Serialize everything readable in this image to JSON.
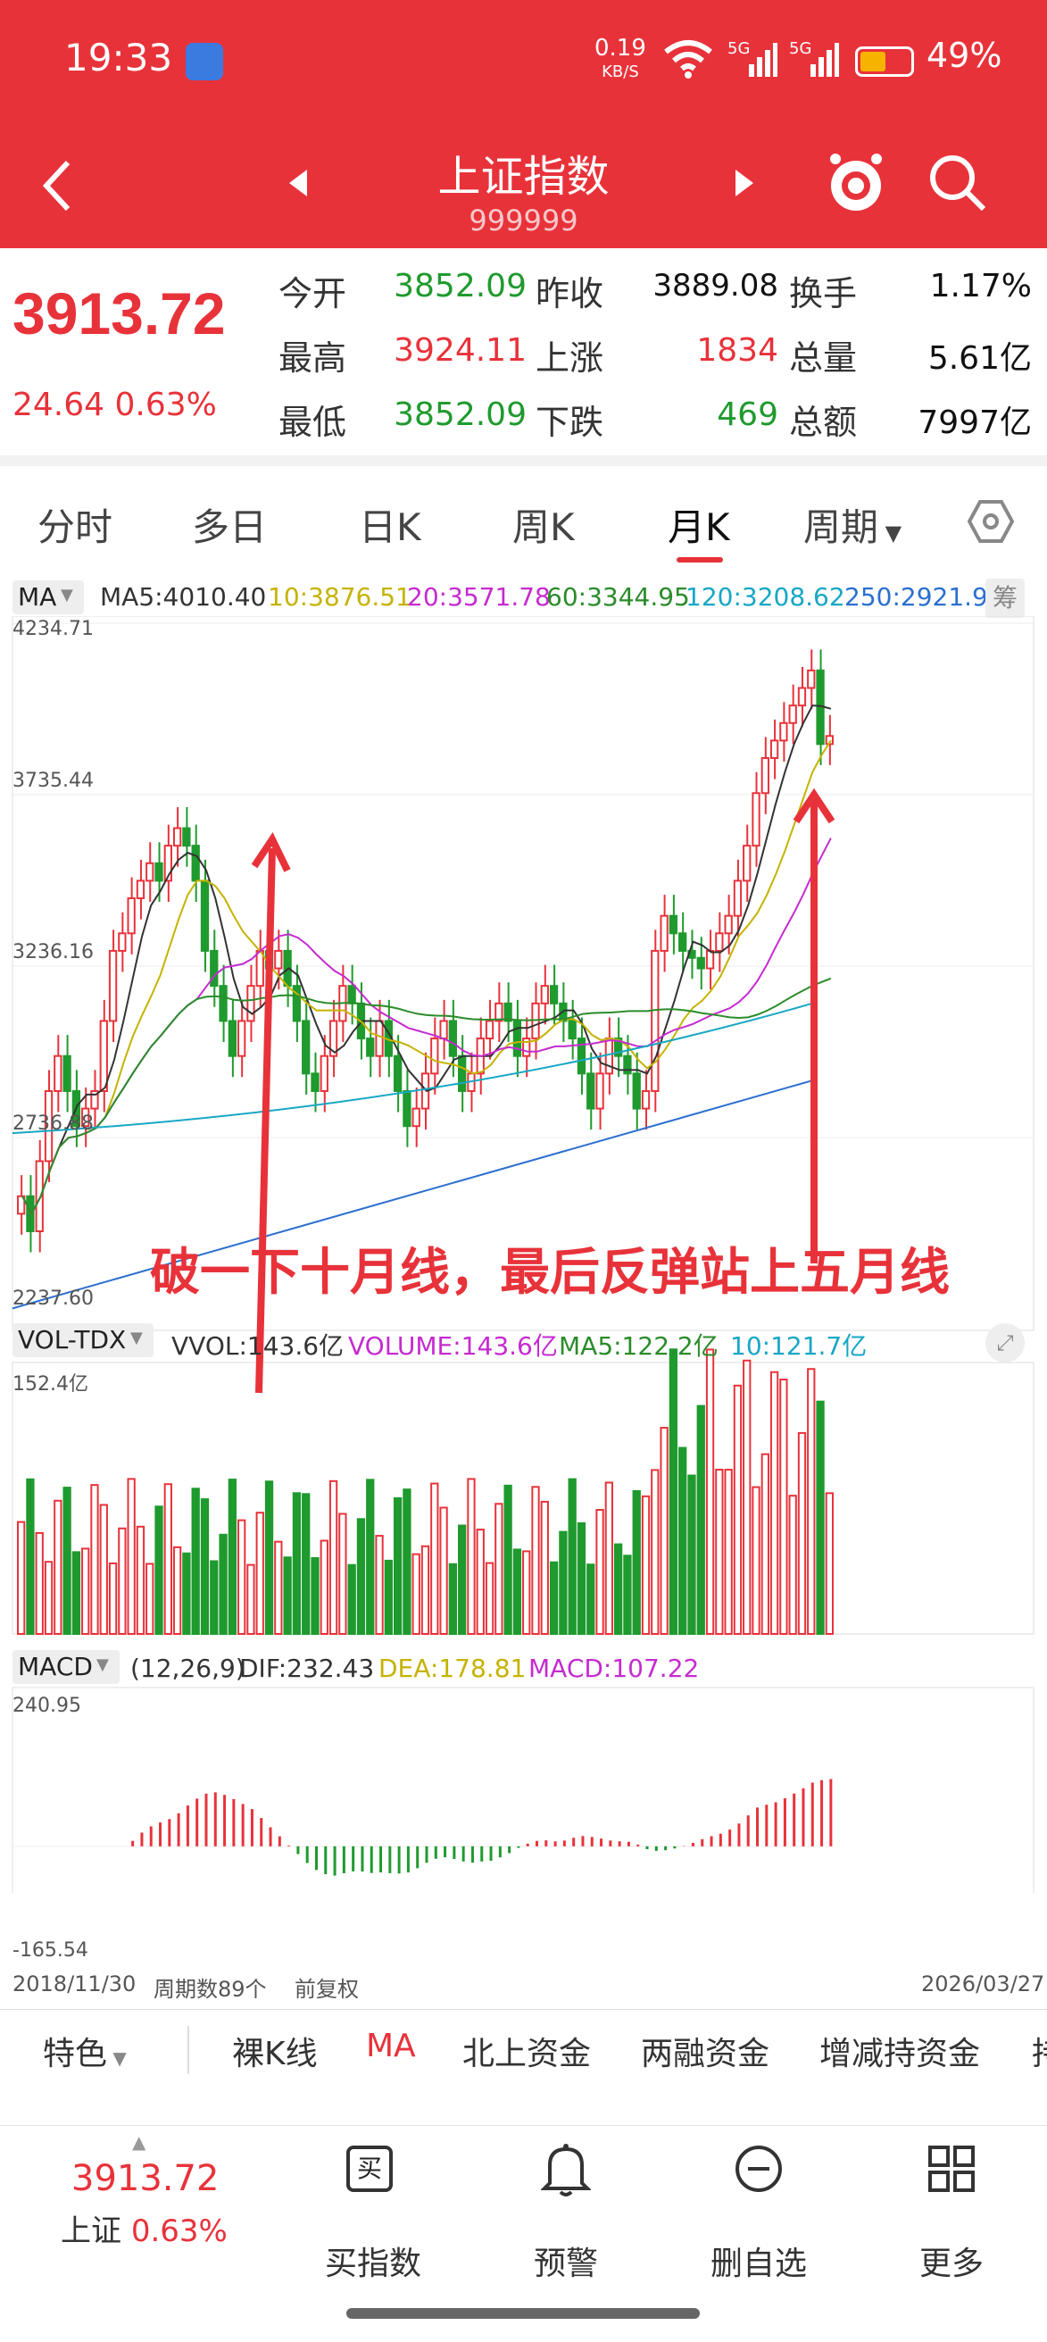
{
  "status": {
    "time": "19:33",
    "net_speed": "0.19",
    "net_unit": "KB/S",
    "sig1": "5G",
    "sig2": "5G",
    "battery": "49%"
  },
  "title": {
    "name": "上证指数",
    "code": "999999"
  },
  "quote": {
    "price": "3913.72",
    "change": "24.64",
    "pct": "0.63%",
    "rows": [
      {
        "l1": "今开",
        "v1": "3852.09",
        "l2": "昨收",
        "v2": "3889.08",
        "l3": "换手",
        "v3": "1.17%"
      },
      {
        "l1": "最高",
        "v1": "3924.11",
        "l2": "上涨",
        "v2": "1834",
        "l3": "总量",
        "v3": "5.61亿"
      },
      {
        "l1": "最低",
        "v1": "3852.09",
        "l2": "下跌",
        "v2": "469",
        "l3": "总额",
        "v3": "7997亿"
      }
    ]
  },
  "tabs": [
    "分时",
    "多日",
    "日K",
    "周K",
    "月K",
    "周期"
  ],
  "ma": {
    "name": "MA",
    "ma5": "MA5:4010.40",
    "ma10": "10:3876.51",
    "ma20": "20:3571.78",
    "ma60": "60:3344.95",
    "ma120": "120:3208.62",
    "ma250": "250:2921.9",
    "chip": "筹"
  },
  "price_axis": [
    "4234.71",
    "3735.44",
    "3236.16",
    "2736.88",
    "2237.60"
  ],
  "annotation": "破一下十月线，最后反弹站上五月线",
  "vol": {
    "name": "VOL-TDX",
    "vvol": "VVOL:143.6亿",
    "volume": "VOLUME:143.6亿",
    "ma5": "MA5:122.2亿",
    "ma10": "10:121.7亿",
    "axis_top": "152.4亿"
  },
  "macd": {
    "name": "MACD",
    "params": "(12,26,9)",
    "dif": "DIF:232.43",
    "dea": "DEA:178.81",
    "macd": "MACD:107.22",
    "axis_top": "240.95",
    "axis_bot": "-165.54"
  },
  "footer": {
    "start": "2018/11/30",
    "periods": "周期数89个",
    "adj": "前复权",
    "end": "2026/03/27"
  },
  "features": [
    "特色",
    "裸K线",
    "MA",
    "北上资金",
    "两融资金",
    "增减持资金",
    "持"
  ],
  "bottom": {
    "price": "3913.72",
    "name": "上证",
    "pct": "0.63%",
    "b1": "买指数",
    "b1_icon": "买",
    "b2": "预警",
    "b3": "删自选",
    "b4": "更多"
  },
  "colors": {
    "red": "#e8323a",
    "green": "#1f9a2e"
  }
}
